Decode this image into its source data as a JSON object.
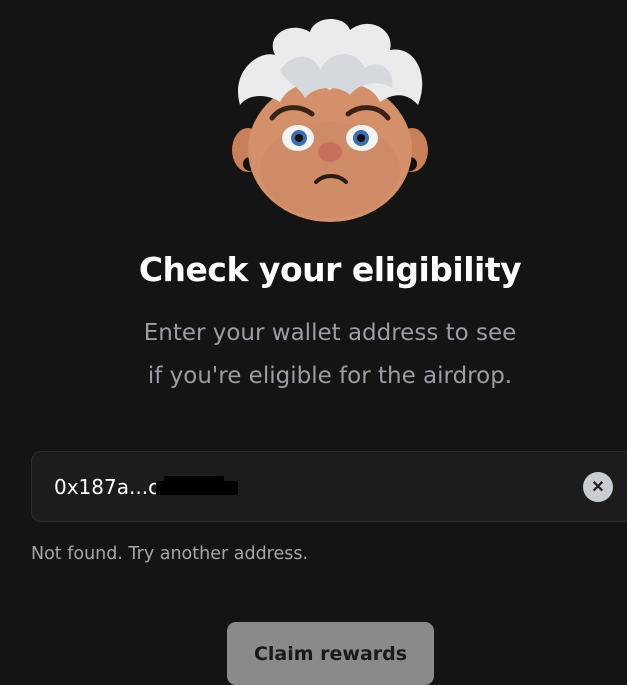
{
  "header": {
    "title": "Check your eligibility",
    "subtitle_line1": "Enter your wallet address to see",
    "subtitle_line2": "if you're eligible for the airdrop."
  },
  "wallet_input": {
    "value": "0x187a...c",
    "clear_icon": "close-icon"
  },
  "status": {
    "message": "Not found. Try another address."
  },
  "actions": {
    "claim_label": "Claim rewards"
  },
  "colors": {
    "background": "#141414",
    "input_background": "#1c1c1c",
    "button_disabled": "#8a8a8a"
  }
}
